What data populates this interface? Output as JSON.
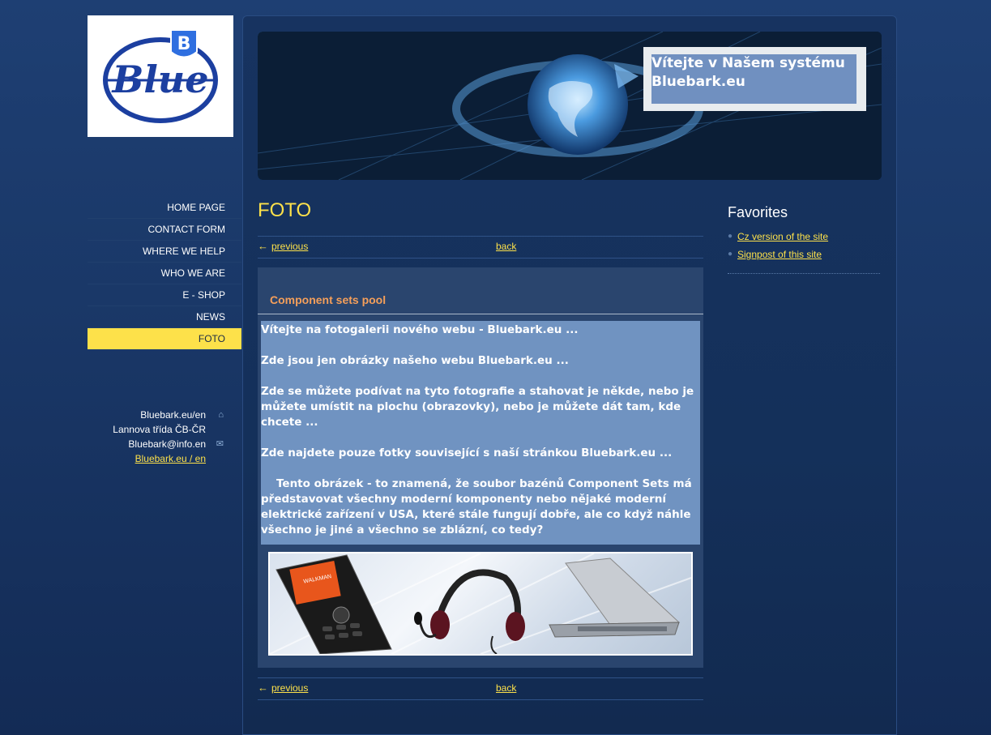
{
  "logo": {
    "text": "Blue",
    "badge": "B"
  },
  "banner": {
    "welcome_text": "Vítejte v Našem systému Bluebark.eu"
  },
  "nav": {
    "items": [
      {
        "label": "HOME PAGE",
        "active": false
      },
      {
        "label": "CONTACT FORM",
        "active": false
      },
      {
        "label": "WHERE WE HELP",
        "active": false
      },
      {
        "label": "WHO WE ARE",
        "active": false
      },
      {
        "label": "E - SHOP",
        "active": false
      },
      {
        "label": "NEWS",
        "active": false
      },
      {
        "label": "FOTO",
        "active": true
      }
    ]
  },
  "contact": {
    "site": "Bluebark.eu/en",
    "address": "Lannova třída ČB-ČR",
    "email": "Bluebark@info.en",
    "link": "Bluebark.eu / en"
  },
  "main": {
    "title": "FOTO",
    "pager": {
      "previous": "previous",
      "back": "back"
    },
    "gallery": {
      "heading": "Component sets pool",
      "paragraphs": [
        "Vítejte na fotogalerii nového webu - Bluebark.eu ...",
        "Zde jsou jen obrázky našeho webu Bluebark.eu ...",
        "Zde se můžete podívat na tyto fotografie a stahovat je někde, nebo je můžete umístit na plochu (obrazovky), nebo je můžete dát tam, kde chcete ...",
        "Zde najdete pouze fotky související s naší stránkou Bluebark.eu ...",
        "Tento obrázek - to znamená, že soubor bazénů Component Sets má představovat všechny moderní komponenty nebo nějaké moderní elektrické zařízení v USA, které stále fungují dobře, ale co když náhle všechno je jiné a všechno se zblázní, co tedy?"
      ],
      "phone_brand": "WALKMAN"
    }
  },
  "sidebar": {
    "title": "Favorites",
    "links": [
      "Cz version of the site",
      "Signpost of this site"
    ]
  },
  "colors": {
    "accent": "#fde14a",
    "heading_orange": "#f59f5a",
    "desc_bg": "#7093c1"
  }
}
